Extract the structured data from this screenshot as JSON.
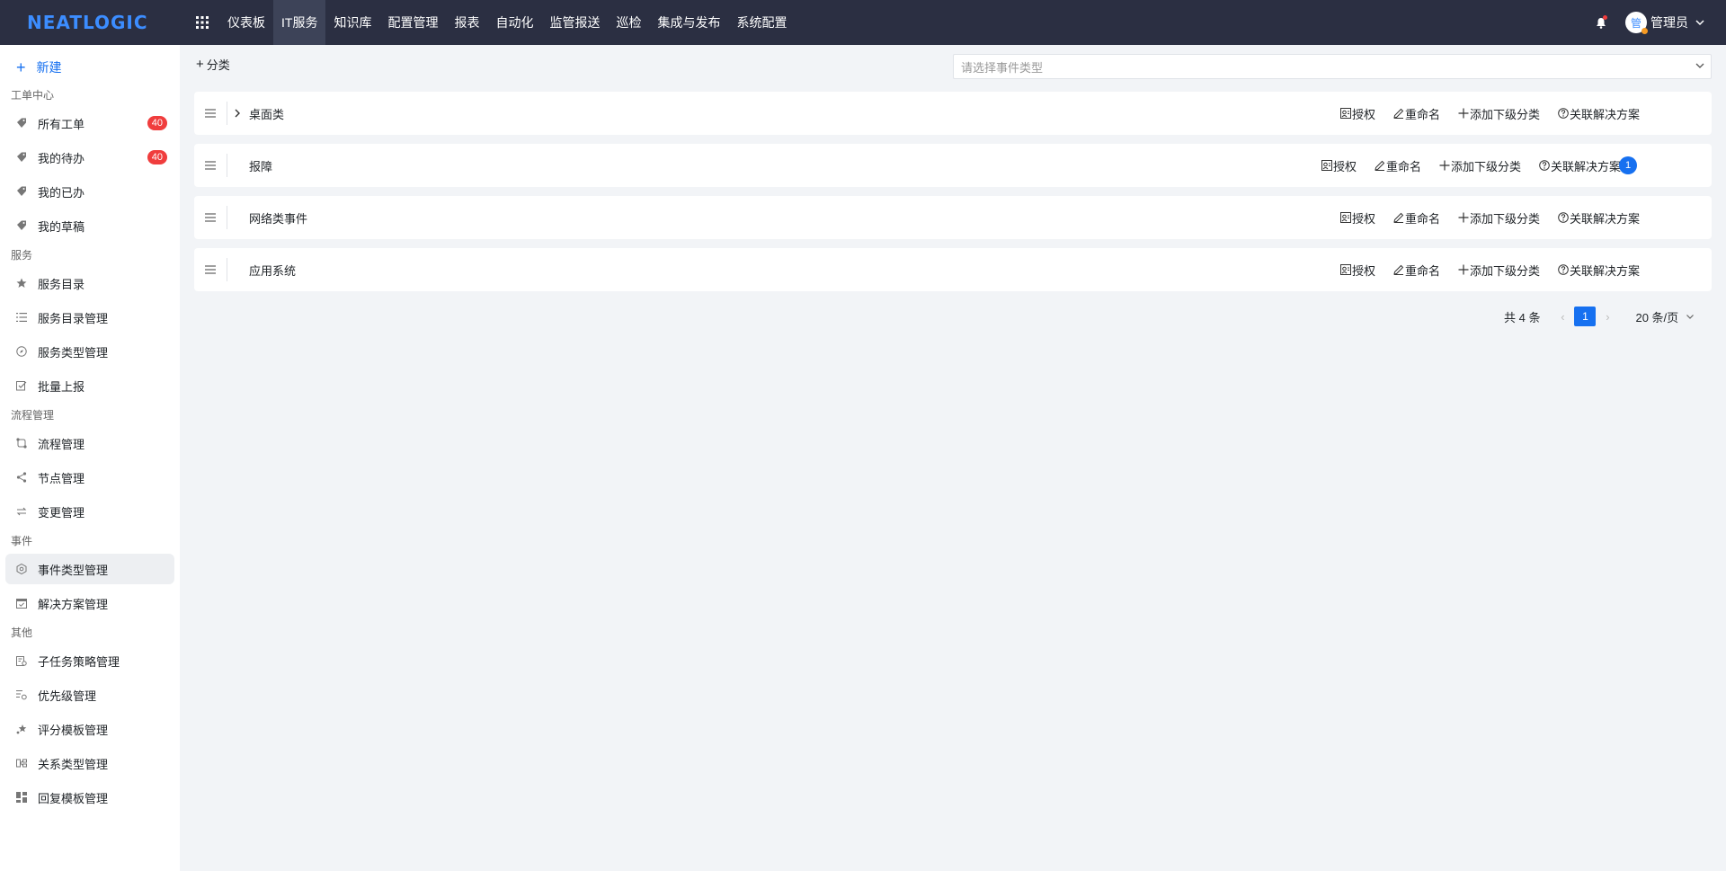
{
  "app": {
    "logo": "NEATLOGIC"
  },
  "topnav": {
    "items": [
      {
        "label": "仪表板"
      },
      {
        "label": "IT服务"
      },
      {
        "label": "知识库"
      },
      {
        "label": "配置管理"
      },
      {
        "label": "报表"
      },
      {
        "label": "自动化"
      },
      {
        "label": "监管报送"
      },
      {
        "label": "巡检"
      },
      {
        "label": "集成与发布"
      },
      {
        "label": "系统配置"
      }
    ],
    "active_index": 1,
    "user_avatar": "管",
    "user_name": "管理员"
  },
  "sidebar": {
    "new_label": "新建",
    "groups": [
      {
        "title": "工单中心",
        "items": [
          {
            "label": "所有工单",
            "icon": "tag-icon",
            "badge": "40"
          },
          {
            "label": "我的待办",
            "icon": "tag-icon",
            "badge": "40"
          },
          {
            "label": "我的已办",
            "icon": "tag-icon"
          },
          {
            "label": "我的草稿",
            "icon": "tag-icon"
          }
        ]
      },
      {
        "title": "服务",
        "items": [
          {
            "label": "服务目录",
            "icon": "star-icon"
          },
          {
            "label": "服务目录管理",
            "icon": "list-icon"
          },
          {
            "label": "服务类型管理",
            "icon": "compass-icon"
          },
          {
            "label": "批量上报",
            "icon": "batch-report-icon"
          }
        ]
      },
      {
        "title": "流程管理",
        "items": [
          {
            "label": "流程管理",
            "icon": "flow-icon"
          },
          {
            "label": "节点管理",
            "icon": "share-node-icon"
          },
          {
            "label": "变更管理",
            "icon": "swap-icon"
          }
        ]
      },
      {
        "title": "事件",
        "items": [
          {
            "label": "事件类型管理",
            "icon": "hexagon-icon",
            "active": true
          },
          {
            "label": "解决方案管理",
            "icon": "calendar-check-icon"
          }
        ]
      },
      {
        "title": "其他",
        "items": [
          {
            "label": "子任务策略管理",
            "icon": "task-policy-icon"
          },
          {
            "label": "优先级管理",
            "icon": "priority-icon"
          },
          {
            "label": "评分模板管理",
            "icon": "score-star-icon"
          },
          {
            "label": "关系类型管理",
            "icon": "relation-icon"
          },
          {
            "label": "回复模板管理",
            "icon": "template-grid-icon"
          }
        ]
      }
    ]
  },
  "main": {
    "add_category_label": "分类",
    "event_type_select_placeholder": "请选择事件类型",
    "rows": [
      {
        "name": "桌面类",
        "expandable": true
      },
      {
        "name": "报障",
        "expandable": false,
        "solution_count": "1"
      },
      {
        "name": "网络类事件",
        "expandable": false
      },
      {
        "name": "应用系统",
        "expandable": false
      }
    ],
    "actions": {
      "authorize": "授权",
      "rename": "重命名",
      "add_sub": "添加下级分类",
      "link_solution": "关联解决方案"
    },
    "pagination": {
      "total": "共 4 条",
      "current_page": "1",
      "page_size": "20 条/页"
    }
  },
  "colors": {
    "topbar_bg": "#2b2f42",
    "accent": "#1670f0",
    "badge_red": "#f03d3d",
    "page_bg": "#f2f4f7"
  }
}
